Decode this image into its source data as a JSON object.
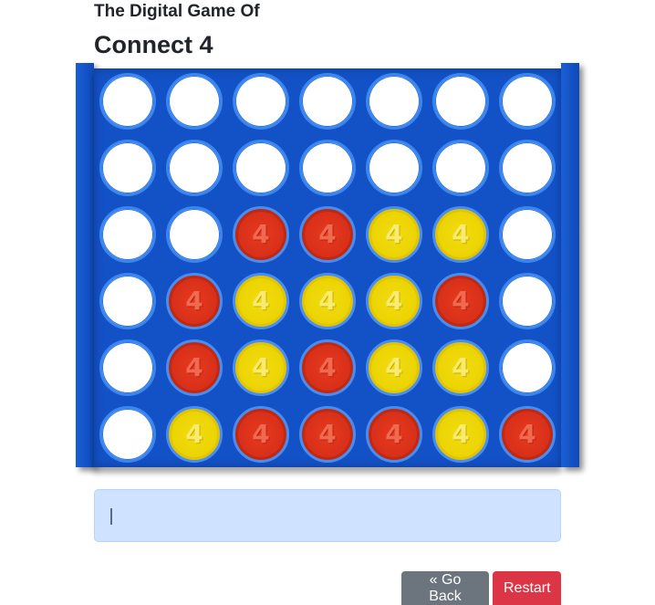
{
  "header": {
    "subtitle": "The Digital Game Of",
    "title": "Connect 4"
  },
  "board": {
    "rows": 6,
    "columns": 7,
    "piece_label": "4",
    "colors": {
      "board": "#1351c6",
      "red": "#d8301a",
      "yellow": "#ecd404",
      "empty": "#ffffff"
    },
    "cells": [
      [
        "empty",
        "empty",
        "empty",
        "empty",
        "empty",
        "empty",
        "empty"
      ],
      [
        "empty",
        "empty",
        "empty",
        "empty",
        "empty",
        "empty",
        "empty"
      ],
      [
        "empty",
        "empty",
        "red",
        "red",
        "yellow",
        "yellow",
        "empty"
      ],
      [
        "empty",
        "red",
        "yellow",
        "yellow",
        "yellow",
        "red",
        "empty"
      ],
      [
        "empty",
        "red",
        "yellow",
        "red",
        "yellow",
        "yellow",
        "empty"
      ],
      [
        "empty",
        "yellow",
        "red",
        "red",
        "red",
        "yellow",
        "red"
      ]
    ]
  },
  "status": {
    "message": ""
  },
  "buttons": {
    "go_back_label": "« Go Back",
    "restart_label": "Restart"
  }
}
